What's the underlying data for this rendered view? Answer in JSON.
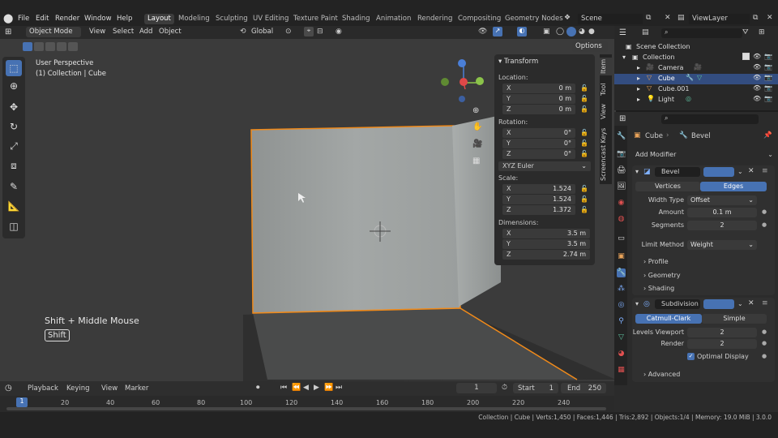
{
  "menu": [
    "File",
    "Edit",
    "Render",
    "Window",
    "Help"
  ],
  "workspaces": [
    "Layout",
    "Modeling",
    "Sculpting",
    "UV Editing",
    "Texture Paint",
    "Shading",
    "Animation",
    "Rendering",
    "Compositing",
    "Geometry Nodes"
  ],
  "scene": {
    "label": "Scene"
  },
  "viewlayer": {
    "label": "ViewLayer"
  },
  "header": {
    "mode": "Object Mode",
    "view": "View",
    "select": "Select",
    "add": "Add",
    "object": "Object",
    "orientation": "Global",
    "options": "Options"
  },
  "viewport": {
    "perspective": "User Perspective",
    "collection": "(1) Collection | Cube",
    "hint": "Shift + Middle Mouse",
    "key": "Shift"
  },
  "npanel": {
    "title": "Transform",
    "location_label": "Location:",
    "location": [
      {
        "axis": "X",
        "value": "0 m"
      },
      {
        "axis": "Y",
        "value": "0 m"
      },
      {
        "axis": "Z",
        "value": "0 m"
      }
    ],
    "rotation_label": "Rotation:",
    "rotation": [
      {
        "axis": "X",
        "value": "0°"
      },
      {
        "axis": "Y",
        "value": "0°"
      },
      {
        "axis": "Z",
        "value": "0°"
      }
    ],
    "rotation_mode": "XYZ Euler",
    "scale_label": "Scale:",
    "scale": [
      {
        "axis": "X",
        "value": "1.524"
      },
      {
        "axis": "Y",
        "value": "1.524"
      },
      {
        "axis": "Z",
        "value": "1.372"
      }
    ],
    "dimensions_label": "Dimensions:",
    "dimensions": [
      {
        "axis": "X",
        "value": "3.5 m"
      },
      {
        "axis": "Y",
        "value": "3.5 m"
      },
      {
        "axis": "Z",
        "value": "2.74 m"
      }
    ]
  },
  "sidetabs": [
    "Item",
    "Tool",
    "View",
    "Screencast Keys"
  ],
  "timeline": {
    "playback": "Playback",
    "keying": "Keying",
    "view": "View",
    "marker": "Marker",
    "current_frame": "1",
    "start_label": "Start",
    "start": "1",
    "end_label": "End",
    "end": "250",
    "ticks": [
      "1",
      "20",
      "40",
      "60",
      "80",
      "100",
      "120",
      "140",
      "160",
      "180",
      "200",
      "220",
      "240"
    ]
  },
  "status": "Collection | Cube | Verts:1,450 | Faces:1,446 | Tris:2,892 | Objects:1/4 | Memory: 19.0 MiB | 3.0.0",
  "outliner": {
    "root": "Scene Collection",
    "collection": "Collection",
    "items": [
      {
        "name": "Camera"
      },
      {
        "name": "Cube"
      },
      {
        "name": "Cube.001"
      },
      {
        "name": "Light"
      }
    ]
  },
  "properties": {
    "object": "Cube",
    "modifier_crumb": "Bevel",
    "add_modifier": "Add Modifier",
    "bevel": {
      "name": "Bevel",
      "tab_vertices": "Vertices",
      "tab_edges": "Edges",
      "width_type_label": "Width Type",
      "width_type": "Offset",
      "amount_label": "Amount",
      "amount": "0.1 m",
      "segments_label": "Segments",
      "segments": "2",
      "limit_label": "Limit Method",
      "limit": "Weight",
      "profile": "Profile",
      "geometry": "Geometry",
      "shading": "Shading"
    },
    "subdivision": {
      "name": "Subdivision",
      "tab_catmull": "Catmull-Clark",
      "tab_simple": "Simple",
      "levels_label": "Levels Viewport",
      "levels": "2",
      "render_label": "Render",
      "render": "2",
      "optimal": "Optimal Display",
      "advanced": "Advanced"
    }
  }
}
